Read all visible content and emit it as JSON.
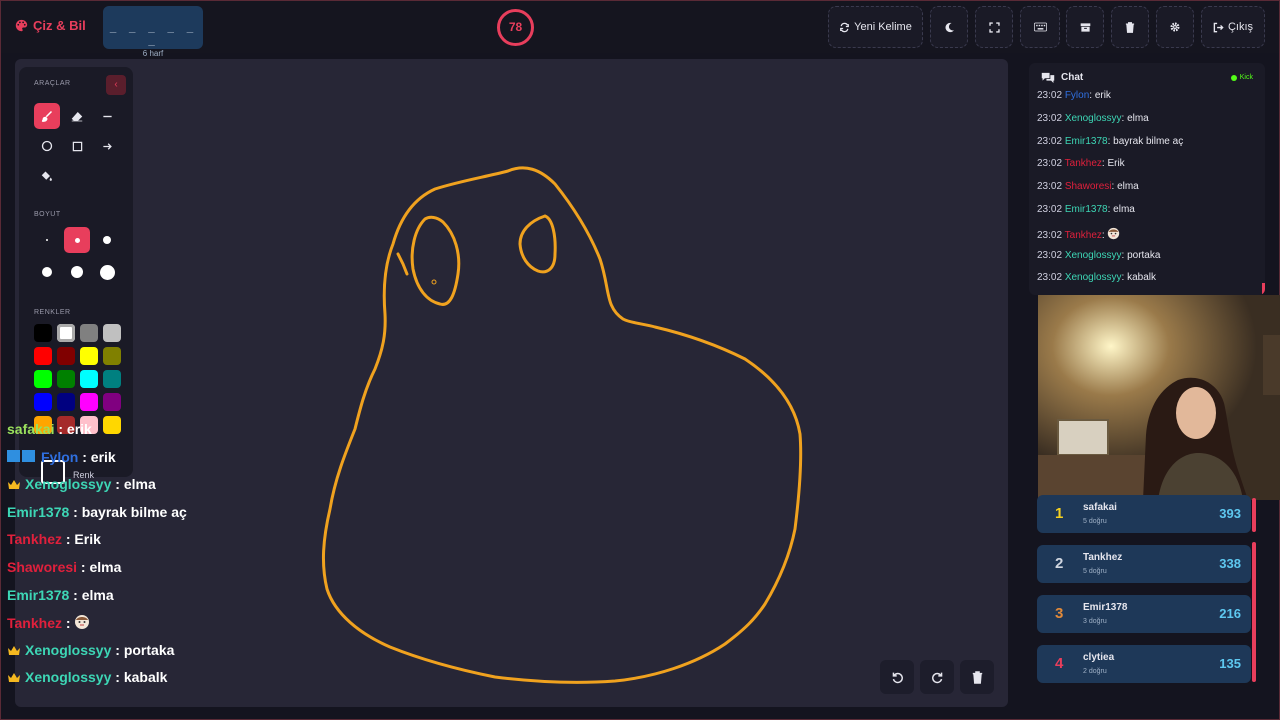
{
  "header": {
    "brand": "Çiz & Bil",
    "word_mask": "_ _ _ _ _ _",
    "letter_count": "6 harf",
    "timer": "78",
    "new_word_label": "Yeni Kelime",
    "exit_label": "Çıkış"
  },
  "tools": {
    "title_tools": "ARAÇLAR",
    "title_size": "BOYUT",
    "title_colors": "RENKLER",
    "custom_color_label": "Renk",
    "items": [
      "brush",
      "eraser",
      "line",
      "circle",
      "rectangle",
      "arrow",
      "fill"
    ],
    "active_tool": "brush",
    "sizes": [
      2,
      5,
      8,
      10,
      12,
      15
    ],
    "active_size_index": 1,
    "palette": [
      "#000000",
      "#ffffff",
      "#808080",
      "#c0c0c0",
      "#ff0000",
      "#800000",
      "#ffff00",
      "#808000",
      "#00ff00",
      "#008000",
      "#00ffff",
      "#008080",
      "#0000ff",
      "#000080",
      "#ff00ff",
      "#800080",
      "#ffa500",
      "#a52a2a",
      "#ffc0cb",
      "#ffd700"
    ],
    "selected_color": "#ffffff"
  },
  "drawing": {
    "stroke_color": "#f0a21f"
  },
  "overlay_chat": [
    {
      "user": "safakai",
      "color": "#9be15d",
      "msg": "erik",
      "badge": ""
    },
    {
      "user": "Fylon",
      "color": "#2f6fe0",
      "msg": "erik",
      "badge": "app"
    },
    {
      "user": "Xenoglossyy",
      "color": "#3dd6b5",
      "msg": "elma",
      "badge": "crown"
    },
    {
      "user": "Emir1378",
      "color": "#3dd6b5",
      "msg": "bayrak bilme aç",
      "badge": ""
    },
    {
      "user": "Tankhez",
      "color": "#e0203c",
      "msg": "Erik",
      "badge": ""
    },
    {
      "user": "Shaworesi",
      "color": "#e0203c",
      "msg": "elma",
      "badge": ""
    },
    {
      "user": "Emir1378",
      "color": "#3dd6b5",
      "msg": "elma",
      "badge": ""
    },
    {
      "user": "Tankhez",
      "color": "#e0203c",
      "msg": "",
      "badge": "",
      "emote": true
    },
    {
      "user": "Xenoglossyy",
      "color": "#3dd6b5",
      "msg": "portaka",
      "badge": "crown"
    },
    {
      "user": "Xenoglossyy",
      "color": "#3dd6b5",
      "msg": "kabalk",
      "badge": "crown"
    }
  ],
  "chat": {
    "title": "Chat",
    "platform": "Kick",
    "messages": [
      {
        "time": "23:02",
        "user": "Fylon",
        "color": "#2f6fe0",
        "msg": "erik"
      },
      {
        "time": "23:02",
        "user": "Xenoglossyy",
        "color": "#3dd6b5",
        "msg": "elma"
      },
      {
        "time": "23:02",
        "user": "Emir1378",
        "color": "#3dd6b5",
        "msg": "bayrak bilme aç"
      },
      {
        "time": "23:02",
        "user": "Tankhez",
        "color": "#e0203c",
        "msg": "Erik"
      },
      {
        "time": "23:02",
        "user": "Shaworesi",
        "color": "#e0203c",
        "msg": "elma"
      },
      {
        "time": "23:02",
        "user": "Emir1378",
        "color": "#3dd6b5",
        "msg": "elma"
      },
      {
        "time": "23:02",
        "user": "Tankhez",
        "color": "#e0203c",
        "msg": "",
        "emote": true
      },
      {
        "time": "23:02",
        "user": "Xenoglossyy",
        "color": "#3dd6b5",
        "msg": "portaka"
      },
      {
        "time": "23:02",
        "user": "Xenoglossyy",
        "color": "#3dd6b5",
        "msg": "kabalk"
      }
    ]
  },
  "leaderboard": [
    {
      "rank": "1",
      "rank_color": "#f5d020",
      "name": "safakai",
      "correct": "5 doğru",
      "score": "393"
    },
    {
      "rank": "2",
      "rank_color": "#d0d6e0",
      "name": "Tankhez",
      "correct": "5 doğru",
      "score": "338"
    },
    {
      "rank": "3",
      "rank_color": "#e0893a",
      "name": "Emir1378",
      "correct": "3 doğru",
      "score": "216"
    },
    {
      "rank": "4",
      "rank_color": "#e83e5c",
      "name": "clytiea",
      "correct": "2 doğru",
      "score": "135"
    }
  ]
}
